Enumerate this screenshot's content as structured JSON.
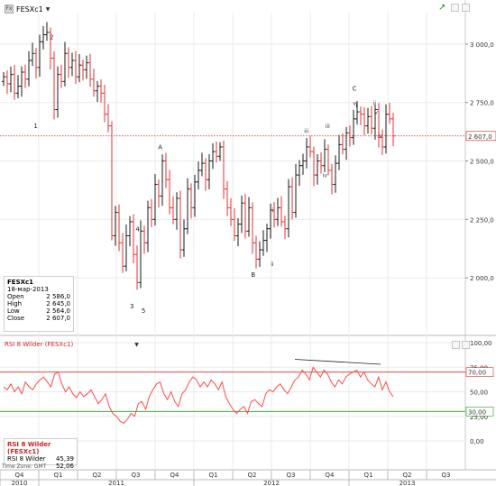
{
  "toolbar": {
    "symbol": "FESXc1",
    "symbol_icon": "chart-type-icon",
    "dropdown_icon": "chevron-down-icon",
    "live_icon": "live-update-icon"
  },
  "colors": {
    "up": "#1a1a1a",
    "down": "#e63232",
    "rsi": "#ff4a4a",
    "overbought": "#d83030",
    "oversold": "#20a020",
    "price_line": "#d02020",
    "grid": "#ebebeb"
  },
  "price_axis": {
    "ticks": [
      "3 000,0",
      "2 750,0",
      "2 500,0",
      "2 250,0",
      "2 000,0"
    ],
    "last_price_label": "2 607,0"
  },
  "rsi_axis": {
    "ticks": [
      "100,00",
      "75,00",
      "50,00",
      "25,00",
      "0,00"
    ],
    "level_70_label": "70,00",
    "level_30_label": "30,00"
  },
  "wave_labels": [
    "1",
    "2",
    "3",
    "4",
    "5",
    "A",
    "B",
    "C",
    "i",
    "ii",
    "iii",
    "iv",
    "v",
    "i",
    "ii",
    "iii",
    "iv",
    "v"
  ],
  "info_panel": {
    "title": "FESXc1",
    "date": "18-мар-2013",
    "rows": [
      {
        "label": "Open",
        "value": "2 586,0"
      },
      {
        "label": "High",
        "value": "2 645,0"
      },
      {
        "label": "Low",
        "value": "2 564,0"
      },
      {
        "label": "Close",
        "value": "2 607,0"
      }
    ]
  },
  "rsi_panel": {
    "title": "RSI 8 Wilder (FESXc1)",
    "header_label": "RSI 8 Wilder (FESXc1)",
    "rows": [
      {
        "label": "RSI 8 Wilder",
        "value": "45,39"
      },
      {
        "label": "",
        "value": "52,06"
      }
    ]
  },
  "time_axis": {
    "timezone": "Time Zone: GMT",
    "quarters": [
      "Q4",
      "Q1",
      "Q2",
      "Q3",
      "Q4",
      "Q1",
      "Q2",
      "Q3",
      "Q4",
      "Q1",
      "Q2",
      "Q3"
    ],
    "years": [
      "2010",
      "2011",
      "2012",
      "2013"
    ]
  },
  "chart_data": [
    {
      "type": "ohlc",
      "series_name": "FESXc1",
      "x_unit": "quarter index (0 = 2010 Q4, 1 = 2011 Q1, …)",
      "ylim": [
        1800,
        3150
      ],
      "last_close": 2607,
      "closes": [
        2860,
        2830,
        2870,
        2790,
        2820,
        2880,
        2850,
        2930,
        2960,
        2900,
        3010,
        3040,
        3050,
        2940,
        2720,
        2870,
        2840,
        2960,
        2900,
        2930,
        2860,
        2910,
        2890,
        2920,
        2850,
        2800,
        2820,
        2790,
        2700,
        2650,
        2180,
        2280,
        2150,
        2050,
        2180,
        2240,
        2100,
        1980,
        2200,
        2150,
        2300,
        2250,
        2400,
        2350,
        2500,
        2420,
        2300,
        2250,
        2340,
        2120,
        2210,
        2380,
        2300,
        2410,
        2460,
        2490,
        2420,
        2500,
        2540,
        2520,
        2560,
        2380,
        2300,
        2250,
        2180,
        2230,
        2320,
        2200,
        2300,
        2150,
        2080,
        2120,
        2160,
        2210,
        2290,
        2250,
        2300,
        2240,
        2210,
        2390,
        2280,
        2440,
        2480,
        2500,
        2560,
        2540,
        2440,
        2500,
        2480,
        2550,
        2460,
        2400,
        2490,
        2570,
        2550,
        2620,
        2600,
        2680,
        2710,
        2700,
        2650,
        2690,
        2640,
        2720,
        2600,
        2560,
        2700,
        2680,
        2607
      ],
      "wave_points": [
        {
          "label": "1",
          "x": 0.92,
          "price": 2640
        },
        {
          "label": "2",
          "x": 1.33,
          "price": 3020
        },
        {
          "label": "3",
          "x": 3.4,
          "price": 1870
        },
        {
          "label": "4",
          "x": 3.55,
          "price": 2200
        },
        {
          "label": "5",
          "x": 3.7,
          "price": 1850
        },
        {
          "label": "A",
          "x": 4.13,
          "price": 2550
        },
        {
          "label": "B",
          "x": 6.53,
          "price": 2005
        },
        {
          "label": "C",
          "x": 9.14,
          "price": 2800
        }
      ]
    },
    {
      "type": "line",
      "series_name": "RSI 8 Wilder",
      "ylim": [
        0,
        100
      ],
      "levels": [
        70,
        30
      ],
      "values": [
        55,
        52,
        58,
        50,
        55,
        48,
        60,
        55,
        52,
        58,
        62,
        65,
        60,
        55,
        68,
        70,
        58,
        50,
        55,
        48,
        44,
        50,
        45,
        48,
        52,
        45,
        38,
        42,
        48,
        35,
        28,
        25,
        20,
        18,
        22,
        28,
        25,
        38,
        40,
        32,
        45,
        52,
        58,
        60,
        48,
        42,
        50,
        40,
        35,
        48,
        52,
        60,
        65,
        62,
        55,
        60,
        55,
        62,
        58,
        52,
        60,
        45,
        38,
        32,
        28,
        32,
        35,
        28,
        40,
        42,
        38,
        35,
        48,
        52,
        50,
        55,
        58,
        52,
        48,
        55,
        62,
        65,
        72,
        68,
        62,
        75,
        70,
        65,
        72,
        68,
        60,
        55,
        62,
        58,
        65,
        68,
        70,
        72,
        65,
        70,
        62,
        58,
        55,
        65,
        52,
        60,
        50,
        45
      ],
      "trendline": {
        "from": [
          0.75,
          83
        ],
        "to": [
          1.0,
          78
        ]
      }
    }
  ]
}
